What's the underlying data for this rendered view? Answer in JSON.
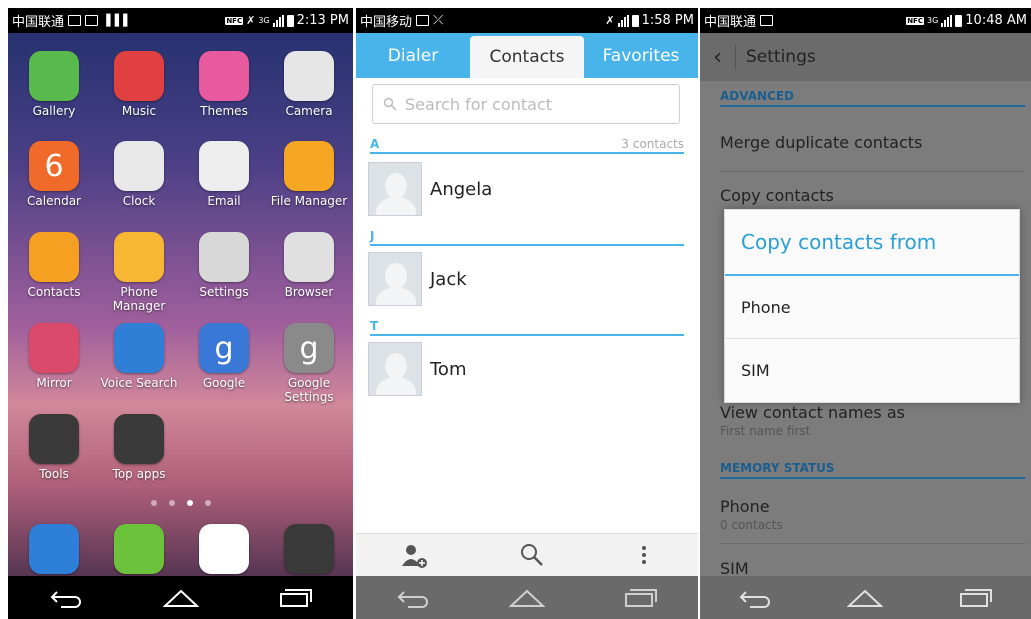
{
  "home": {
    "status": {
      "carrier": "中国联通",
      "time": "2:13 PM",
      "net": "3G"
    },
    "apps": [
      {
        "label": "Gallery",
        "icon": "gallery-icon",
        "color": "#58b94c"
      },
      {
        "label": "Music",
        "icon": "music-icon",
        "color": "#e04040"
      },
      {
        "label": "Themes",
        "icon": "themes-icon",
        "color": "#e85aa0"
      },
      {
        "label": "Camera",
        "icon": "camera-icon",
        "color": "#e6e6e6"
      },
      {
        "label": "Calendar",
        "icon": "calendar-icon",
        "color": "#f06b2a",
        "glyph": "6"
      },
      {
        "label": "Clock",
        "icon": "clock-icon",
        "color": "#e8e8e8"
      },
      {
        "label": "Email",
        "icon": "email-icon",
        "color": "#eeeeee"
      },
      {
        "label": "File Manager",
        "icon": "folder-icon",
        "color": "#f5a623"
      },
      {
        "label": "Contacts",
        "icon": "contacts-icon",
        "color": "#f5a020"
      },
      {
        "label": "Phone Manager",
        "icon": "shield-icon",
        "color": "#f7b733"
      },
      {
        "label": "Settings",
        "icon": "gear-icon",
        "color": "#d8d8d8"
      },
      {
        "label": "Browser",
        "icon": "compass-icon",
        "color": "#e0e0e0"
      },
      {
        "label": "Mirror",
        "icon": "mirror-icon",
        "color": "#d94a6b"
      },
      {
        "label": "Voice Search",
        "icon": "microphone-icon",
        "color": "#2f7fd6"
      },
      {
        "label": "Google",
        "icon": "google-icon",
        "color": "#3a78d8",
        "glyph": "g"
      },
      {
        "label": "Google Settings",
        "icon": "google-settings-icon",
        "color": "#8a8a8a",
        "glyph": "g"
      },
      {
        "label": "Tools",
        "icon": "tools-folder-icon",
        "color": "#3a3a3a"
      },
      {
        "label": "Top apps",
        "icon": "top-apps-folder-icon",
        "color": "#3a3a3a"
      }
    ],
    "dock": [
      {
        "icon": "phone-icon",
        "color": "#2d7fd8"
      },
      {
        "icon": "messaging-icon",
        "color": "#6cc23a"
      },
      {
        "icon": "play-store-icon",
        "color": "#ffffff"
      },
      {
        "icon": "google-apps-folder-icon",
        "color": "#3a3a3a"
      }
    ]
  },
  "contacts": {
    "status": {
      "carrier": "中国移动",
      "time": "1:58 PM"
    },
    "tabs": [
      "Dialer",
      "Contacts",
      "Favorites"
    ],
    "search_placeholder": "Search for contact",
    "count_label": "3 contacts",
    "groups": [
      {
        "letter": "A",
        "name": "Angela"
      },
      {
        "letter": "J",
        "name": "Jack"
      },
      {
        "letter": "T",
        "name": "Tom"
      }
    ]
  },
  "settings": {
    "status": {
      "carrier": "中国联通",
      "time": "10:48 AM",
      "net": "3G"
    },
    "title": "Settings",
    "advanced_header": "ADVANCED",
    "merge": "Merge duplicate contacts",
    "copy": "Copy contacts",
    "view_names": "View contact names as",
    "view_names_sub": "First name first",
    "memory_header": "MEMORY STATUS",
    "phone": "Phone",
    "phone_sub": "0 contacts",
    "sim": "SIM",
    "dialog": {
      "title": "Copy contacts from",
      "options": [
        "Phone",
        "SIM"
      ]
    }
  }
}
